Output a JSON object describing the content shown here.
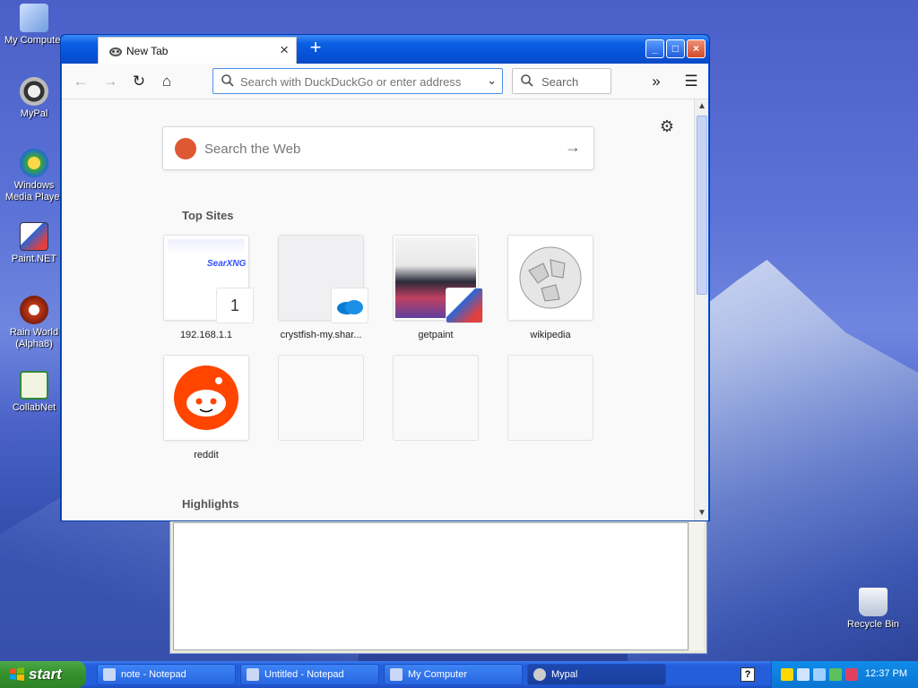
{
  "desktop": {
    "icons": [
      {
        "label": "My Computer"
      },
      {
        "label": "MyPal"
      },
      {
        "label": "Windows Media Player"
      },
      {
        "label": "Paint.NET"
      },
      {
        "label": "Rain World (Alpha8)"
      },
      {
        "label": "CollabNet"
      },
      {
        "label": "Recycle Bin"
      }
    ]
  },
  "browser": {
    "tab_title": "New Tab",
    "tab_close": "×",
    "new_tab": "+",
    "controls": {
      "minimize": "_",
      "maximize": "□",
      "close": "×"
    },
    "nav": {
      "back": "←",
      "forward": "→",
      "reload": "↻",
      "home": "⌂",
      "overflow": "»",
      "menu": "☰"
    },
    "urlbar": {
      "placeholder": "Search with DuckDuckGo or enter address",
      "dropdown": "⌄"
    },
    "searchbox": {
      "placeholder": "Search"
    },
    "newtab_page": {
      "settings": "⚙",
      "web_search_placeholder": "Search the Web",
      "web_search_go": "→",
      "top_sites_title": "Top Sites",
      "highlights_title": "Highlights",
      "tiles": [
        {
          "label": "192.168.1.1",
          "badge": "1"
        },
        {
          "label": "crystfish-my.shar..."
        },
        {
          "label": "getpaint"
        },
        {
          "label": "wikipedia"
        },
        {
          "label": "reddit"
        },
        {
          "label": ""
        },
        {
          "label": ""
        },
        {
          "label": ""
        }
      ]
    }
  },
  "taskbar": {
    "start": "start",
    "tasks": [
      {
        "label": "note - Notepad"
      },
      {
        "label": "Untitled - Notepad"
      },
      {
        "label": "My Computer"
      },
      {
        "label": "Mypal"
      }
    ],
    "help": "?",
    "clock": "12:37 PM"
  },
  "colors": {
    "xp_blue": "#0a56d8",
    "start_green": "#37942f",
    "reddit": "#ff4500",
    "ddg": "#de5833",
    "onedrive": "#0a7bd4"
  }
}
